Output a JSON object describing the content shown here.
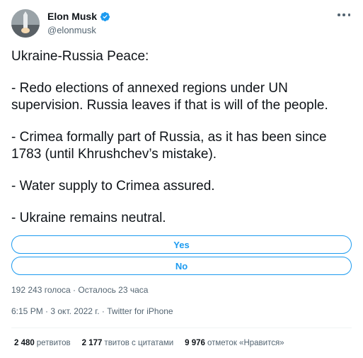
{
  "author": {
    "display_name": "Elon Musk",
    "handle": "@elonmusk",
    "verified": true
  },
  "tweet": {
    "paragraphs": [
      "Ukraine-Russia Peace:",
      "- Redo elections of annexed regions under UN supervision. Russia leaves if that is will of the people.",
      "- Crimea formally part of Russia, as it has been since 1783 (until Khrushchev’s mistake).",
      "- Water supply to Crimea assured.",
      "- Ukraine remains neutral."
    ]
  },
  "poll": {
    "options": [
      "Yes",
      "No"
    ],
    "votes_and_time": "192 243 голоса · Осталось 23 часа"
  },
  "meta": {
    "time": "6:15 PM",
    "date": "3 окт. 2022 г.",
    "source": "Twitter for iPhone",
    "separator": " · "
  },
  "stats": {
    "retweets_count": "2 480",
    "retweets_label": "ретвитов",
    "quotes_count": "2 177",
    "quotes_label": "твитов с цитатами",
    "likes_count": "9 976",
    "likes_label": "отметок «Нравится»"
  },
  "colors": {
    "accent": "#1d9bf0",
    "secondary_text": "#536471",
    "primary_text": "#0f1419"
  },
  "icons": {
    "verified": "verified-badge-icon",
    "more": "more-options-icon"
  }
}
